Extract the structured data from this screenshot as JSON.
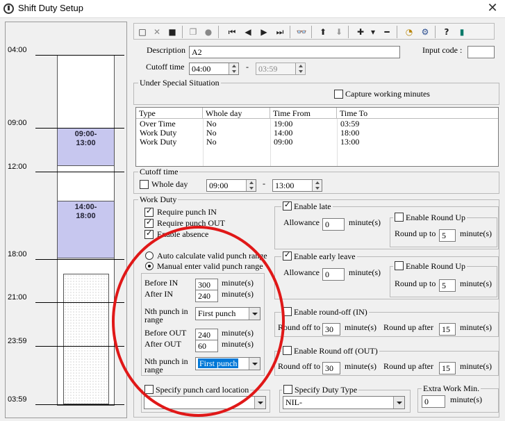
{
  "window": {
    "title": "Shift Duty Setup",
    "close_label": "✕"
  },
  "timeline": {
    "labels": [
      "04:00",
      "09:00",
      "12:00",
      "18:00",
      "21:00",
      "23:59",
      "03:59"
    ],
    "blocks": [
      {
        "start": "09:00",
        "end": "13:00"
      },
      {
        "start": "14:00",
        "end": "18:00"
      }
    ]
  },
  "toolbar": {
    "icons": [
      "new-icon",
      "delete-icon",
      "save-icon",
      "copy-icon",
      "stop-icon",
      "first-record-icon",
      "prev-record-icon",
      "next-record-icon",
      "last-record-icon",
      "find-icon",
      "move-up-icon",
      "move-down-icon",
      "add-icon",
      "add-dropdown-icon",
      "remove-icon",
      "clock-icon",
      "settings-icon",
      "help-icon",
      "exit-icon"
    ],
    "glyphs": [
      "□",
      "✕",
      "■",
      "❐",
      "●",
      "⏮",
      "◀",
      "▶",
      "⏭",
      "👓",
      "⬆",
      "⬇",
      "✚",
      "▾",
      "━",
      "◔",
      "⚙",
      "?",
      "▮"
    ]
  },
  "description": {
    "label": "Description",
    "value": "A2"
  },
  "input_code": {
    "label": "Input code :",
    "value": ""
  },
  "cutoff": {
    "label": "Cutoff time",
    "from": "04:00",
    "dash": "-",
    "to": "03:59"
  },
  "special": {
    "title": "Under Special Situation",
    "capture_label": "Capture working minutes",
    "capture_checked": false
  },
  "duty_table": {
    "headers": [
      "Type",
      "Whole day",
      "Time From",
      "Time To"
    ],
    "rows": [
      [
        "Over Time",
        "No",
        "19:00",
        "03:59"
      ],
      [
        "Work Duty",
        "No",
        "14:00",
        "18:00"
      ],
      [
        "Work Duty",
        "No",
        "09:00",
        "13:00"
      ]
    ]
  },
  "cutoff2": {
    "title": "Cutoff time",
    "whole_day_label": "Whole day",
    "from": "09:00",
    "dash": "-",
    "to": "13:00"
  },
  "work_duty": {
    "title": "Work Duty",
    "require_in": "Require punch IN",
    "require_out": "Require punch OUT",
    "enable_absence": "Enable absence",
    "auto_calc": "Auto calculate valid punch range",
    "manual_enter": "Manual enter valid punch range",
    "before_in_label": "Before IN",
    "before_in_value": "300",
    "after_in_label": "After IN",
    "after_in_value": "240",
    "nth_label_1": "Nth punch in",
    "nth_label_2": "range",
    "nth_value_1": "First punch",
    "before_out_label": "Before OUT",
    "before_out_value": "240",
    "after_out_label": "After OUT",
    "after_out_value": "60",
    "nth_value_2": "First punch",
    "minutes": "minute(s)"
  },
  "late": {
    "enable_label": "Enable late",
    "allowance_label": "Allowance",
    "allowance_value": "0",
    "round_up_label": "Enable Round Up",
    "round_up_to_label": "Round up to",
    "round_up_to_value": "5"
  },
  "early": {
    "enable_label": "Enable early leave",
    "allowance_label": "Allowance",
    "allowance_value": "0",
    "round_up_label": "Enable Round Up",
    "round_up_to_label": "Round up to",
    "round_up_to_value": "5"
  },
  "roundoff_in": {
    "label": "Enable round-off (IN)",
    "round_off_label": "Round off to",
    "round_off_value": "30",
    "round_up_after_label": "Round up after",
    "round_up_after_value": "15"
  },
  "roundoff_out": {
    "label": "Enable Round off (OUT)",
    "round_off_label": "Round off to",
    "round_off_value": "30",
    "round_up_after_label": "Round up after",
    "round_up_after_value": "15"
  },
  "punch_card": {
    "label": "Specify punch card location",
    "value": ""
  },
  "duty_type": {
    "label": "Specify Duty Type",
    "value": "NIL-"
  },
  "extra_work": {
    "label": "Extra Work Min.",
    "value": "0",
    "unit": "minute(s)"
  }
}
